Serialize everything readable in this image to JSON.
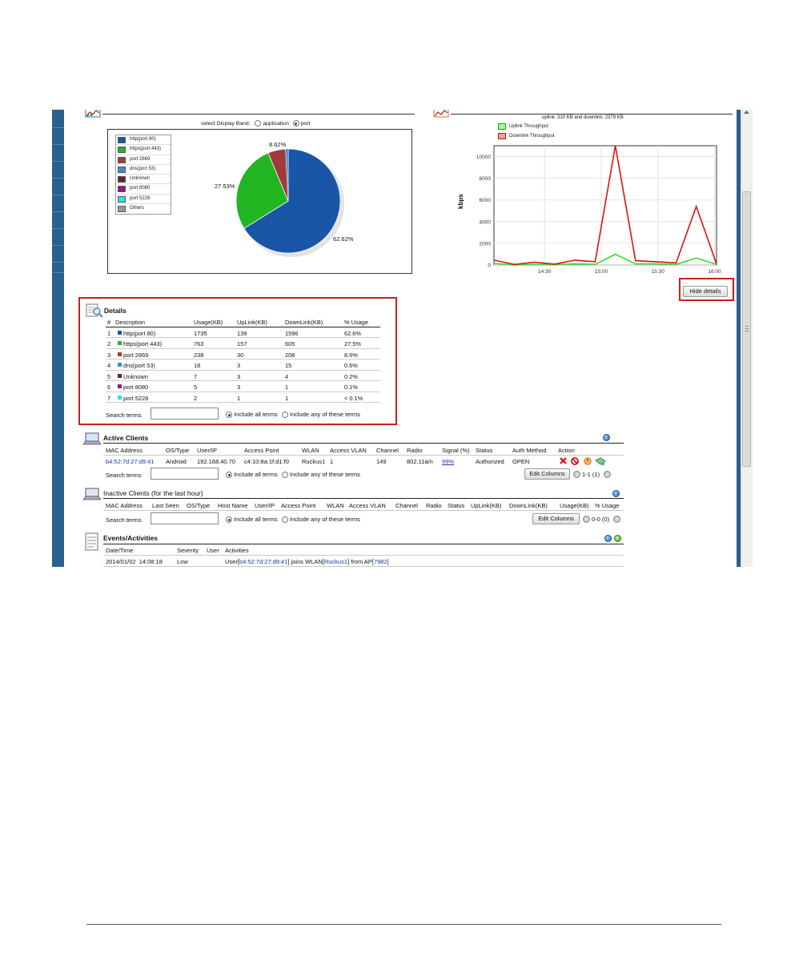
{
  "select_band": {
    "label": "select Display Band:",
    "option_application": "application",
    "option_port": "port"
  },
  "pie": {
    "legend": [
      {
        "label": "http(port 80)",
        "color": "#1a56a8"
      },
      {
        "label": "https(port 443)",
        "color": "#22b522"
      },
      {
        "label": "port 2869",
        "color": "#a33a3a"
      },
      {
        "label": "dns(port 53)",
        "color": "#3f8fc9"
      },
      {
        "label": "Unknown",
        "color": "#5a2732"
      },
      {
        "label": "port 8080",
        "color": "#8a1a8a"
      },
      {
        "label": "port 5228",
        "color": "#22e6e6"
      },
      {
        "label": "Others",
        "color": "#999999"
      }
    ],
    "label_https": "27.53%",
    "label_port2869": "8.62%",
    "label_http": "62.62%"
  },
  "chart_data": {
    "type": "line",
    "title": "uplink: 310 KB and downlink: 2379 KB",
    "xlabel": "",
    "ylabel": "kbps",
    "ylim": [
      0,
      11000
    ],
    "yticks": [
      "0",
      "2000",
      "4000",
      "6000",
      "8000",
      "10000"
    ],
    "xticks": [
      "14:30",
      "15:00",
      "15:30",
      "16:00"
    ],
    "legend_position": "top-left",
    "series": [
      {
        "name": "Uplink Throughput",
        "color": "#33dd33",
        "values": [
          150,
          0,
          50,
          30,
          100,
          60,
          1000,
          100,
          100,
          50,
          650,
          50
        ]
      },
      {
        "name": "Downlink Throughput",
        "color": "#dd1111",
        "values": [
          450,
          50,
          250,
          80,
          450,
          300,
          11000,
          400,
          300,
          200,
          5400,
          100
        ]
      }
    ]
  },
  "hide_details": "Hide details",
  "details": {
    "title": "Details",
    "headers": [
      "#",
      "Description",
      "Usage(KB)",
      "UpLink(KB)",
      "DownLink(KB)",
      "% Usage"
    ],
    "rows": [
      {
        "num": "1",
        "desc": "http(port 80)",
        "color": "#1a56a8",
        "usage": "1735",
        "up": "139",
        "down": "1596",
        "pct": "62.6%"
      },
      {
        "num": "2",
        "desc": "https(port 443)",
        "color": "#22b522",
        "usage": "763",
        "up": "157",
        "down": "605",
        "pct": "27.5%"
      },
      {
        "num": "3",
        "desc": "port 2869",
        "color": "#a33a3a",
        "usage": "238",
        "up": "30",
        "down": "208",
        "pct": "8.6%"
      },
      {
        "num": "4",
        "desc": "dns(port 53)",
        "color": "#3f8fc9",
        "usage": "18",
        "up": "3",
        "down": "15",
        "pct": "0.6%"
      },
      {
        "num": "5",
        "desc": "Unknown",
        "color": "#5a2732",
        "usage": "7",
        "up": "3",
        "down": "4",
        "pct": "0.2%"
      },
      {
        "num": "6",
        "desc": "port 8080",
        "color": "#8a1a8a",
        "usage": "5",
        "up": "3",
        "down": "1",
        "pct": "0.1%"
      },
      {
        "num": "7",
        "desc": "port 5228",
        "color": "#22e6e6",
        "usage": "2",
        "up": "1",
        "down": "1",
        "pct": "< 0.1%"
      }
    ],
    "search_label": "Search terms",
    "include_all": "Include all terms",
    "include_any": "Include any of these terms"
  },
  "active_clients": {
    "title": "Active Clients",
    "headers": [
      "MAC Address",
      "OS/Type",
      "User/IP",
      "Access Point",
      "WLAN",
      "Access VLAN",
      "Channel",
      "Radio",
      "Signal (%)",
      "Status",
      "Auth Method",
      "Action"
    ],
    "row": {
      "mac": "b4:52:7d:27:d9:41",
      "os": "Android",
      "ip": "192.168.40.70",
      "ap": "c4:10:8a:1f:d1:f0",
      "wlan": "Ruckus1",
      "vlan": "1",
      "channel": "149",
      "radio": "802.11a/n",
      "signal": "99%",
      "status": "Authorized",
      "auth": "OPEN"
    },
    "search_label": "Search terms",
    "include_all": "Include all terms",
    "include_any": "Include any of these terms",
    "edit_columns": "Edit Columns",
    "pager": "1-1 (1)"
  },
  "inactive_clients": {
    "title": "Inactive Clients (for the last hour)",
    "headers": [
      "MAC Address",
      "Last Seen",
      "OS/Type",
      "Host Name",
      "User/IP",
      "Access Point",
      "WLAN",
      "Access VLAN",
      "Channel",
      "Radio",
      "Status",
      "UpLink(KB)",
      "DownLink(KB)",
      "Usage(KB)",
      "% Usage"
    ],
    "search_label": "Search terms",
    "include_all": "Include all terms",
    "include_any": "Include any of these terms",
    "edit_columns": "Edit Columns",
    "pager": "0-0 (0)"
  },
  "events": {
    "title": "Events/Activities",
    "headers": [
      "Date/Time",
      "Severity",
      "User",
      "Activities"
    ],
    "row": {
      "datetime": "2014/01/02  14:08:18",
      "severity": "Low",
      "act_prefix": "User[",
      "act_mac": "b4:52:7d:27:d9:41",
      "act_mid": "] joins WLAN[",
      "act_wlan": "Ruckus1",
      "act_from": "] from AP[",
      "act_ap": "7982",
      "act_end": "]"
    }
  }
}
